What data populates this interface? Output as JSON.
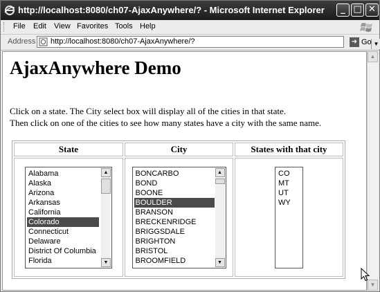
{
  "window": {
    "title": "http://localhost:8080/ch07-AjaxAnywhere/? - Microsoft Internet Explorer",
    "minimize_glyph": "_",
    "maximize_glyph": "□",
    "close_glyph": "✕"
  },
  "menu": [
    "File",
    "Edit",
    "View",
    "Favorites",
    "Tools",
    "Help"
  ],
  "address_bar": {
    "label": "Address",
    "url": "http://localhost:8080/ch07-AjaxAnywhere/?",
    "go_label": "Go"
  },
  "page": {
    "heading": "AjaxAnywhere Demo",
    "instruction_line1": "Click on a state. The City select box will display all of the cities in that state.",
    "instruction_line2": "Then click on one of the cities to see how many states have a city with the same name.",
    "columns": {
      "state": "State",
      "city": "City",
      "states_with_city": "States with that city"
    },
    "states": [
      "Alabama",
      "Alaska",
      "Arizona",
      "Arkansas",
      "California",
      "Colorado",
      "Connecticut",
      "Delaware",
      "District Of Columbia",
      "Florida"
    ],
    "selected_state": "Colorado",
    "cities": [
      "BONCARBO",
      "BOND",
      "BOONE",
      "BOULDER",
      "BRANSON",
      "BRECKENRIDGE",
      "BRIGGSDALE",
      "BRIGHTON",
      "BRISTOL",
      "BROOMFIELD"
    ],
    "selected_city": "BOULDER",
    "matching_states": [
      "CO",
      "MT",
      "UT",
      "WY"
    ]
  }
}
